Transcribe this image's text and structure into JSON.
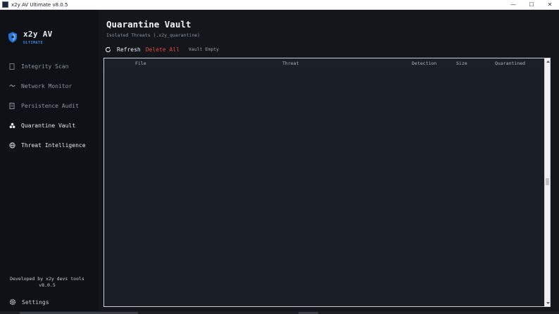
{
  "window": {
    "title": "x2y AV Ultimate v8.0.5",
    "controls": {
      "minimize": "—",
      "maximize": "☐",
      "close": "✕"
    }
  },
  "brand": {
    "name": "x2y AV",
    "edition": "ULTIMATE",
    "accent": "#3f8fe6"
  },
  "sidebar": {
    "items": [
      {
        "label": "Integrity Scan",
        "icon": "file-icon"
      },
      {
        "label": "Network Monitor",
        "icon": "pulse-icon"
      },
      {
        "label": "Persistence Audit",
        "icon": "document-icon"
      },
      {
        "label": "Quarantine Vault",
        "icon": "biohazard-icon",
        "active": true
      },
      {
        "label": "Threat Intelligence",
        "icon": "globe-icon"
      }
    ],
    "credit_line1": "Developed by x2y devs tools",
    "credit_line2": "v8.0.5",
    "settings_label": "Settings"
  },
  "main": {
    "title": "Quarantine Vault",
    "subtitle": "Isolated Threats (.x2y_quarantine)",
    "toolbar": {
      "refresh_label": "Refresh",
      "delete_label": "Delete All",
      "status": "Vault Empty",
      "danger_color": "#e8433a"
    },
    "table": {
      "columns": [
        "File",
        "Threat",
        "Detection",
        "Size",
        "Quarantined"
      ],
      "rows": []
    }
  }
}
